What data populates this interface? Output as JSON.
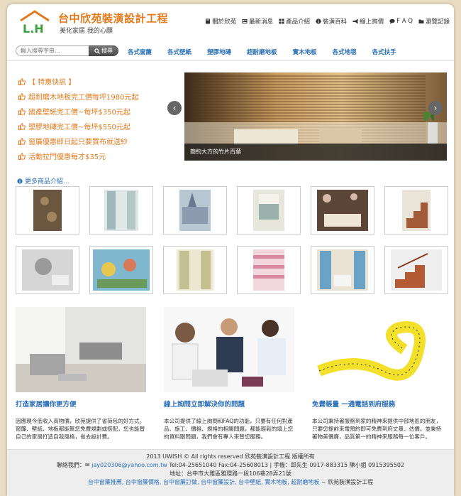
{
  "header": {
    "logo_text": "L.H",
    "title": "台中欣苑裝潢設計工程",
    "subtitle": "美化家居 我的心願",
    "topnav": [
      {
        "label": "關於欣苑",
        "icon": "book-icon"
      },
      {
        "label": "最新消息",
        "icon": "news-icon"
      },
      {
        "label": "產品介紹",
        "icon": "grid-icon"
      },
      {
        "label": "裝潢百科",
        "icon": "info-icon"
      },
      {
        "label": "線上詢價",
        "icon": "megaphone-icon"
      },
      {
        "label": "F A Q",
        "icon": "chat-icon"
      },
      {
        "label": "瀏覽記錄",
        "icon": "folder-icon"
      }
    ]
  },
  "search": {
    "placeholder": "輸入搜尋字串...",
    "button_label": "搜尋"
  },
  "categories": [
    "各式窗簾",
    "各式壁紙",
    "塑膠地磚",
    "超耐磨地板",
    "實木地板",
    "各式地毯",
    "各式扶手"
  ],
  "promo": [
    "【 特惠快訊 】",
    "超耐磨木地板完工價每坪1980元起",
    "國產壁紙完工價~每坪$350元起",
    "塑膠地磚完工價~每坪$550元起",
    "窗簾優惠即日起只要買布就送紗",
    "活動拉門優惠每才$35元"
  ],
  "slider": {
    "caption": "簡約大方的竹片百葉",
    "prev": "‹",
    "next": "›"
  },
  "more_products": "更多商品介紹...",
  "thumbnails": [
    "wallpaper-brown",
    "curtain-white",
    "wallpaper-paris",
    "curtain-window",
    "bedroom-floral",
    "wooden-stairs",
    "wallpaper-living",
    "kids-mural",
    "curtain-lace",
    "pink-stripes",
    "curtain-blue",
    "handrail-stairs"
  ],
  "features": [
    {
      "title": "打造家居讓你更方便",
      "text": "因應現今低收入高物價，欣苑提供了省荷包的好方式。窗簾、壁紙、地板都能幫您免費規劃或搭配，您也能替自己的家居打造自我風格，省去設計費。"
    },
    {
      "title": "線上詢問立即解決你的問題",
      "text": "本公司提供了線上詢問和FAQ的功能，只要有任何對產品、施工、價格、規格的相關問題，都能輕鬆的填上您的資料跟問題，我們會有專人來替您服務。"
    },
    {
      "title": "免費帳量 一通電話到府服務",
      "text": "本公司秉持著服務到家的精神來提供中部地區的朋友，只要您提前來電預約即可免費到府丈量、估價。並秉持著物美價廉，品質第一的精神來服務每一位客戶。"
    }
  ],
  "footer": {
    "copyright": "2013 UWISH © All rights reserved 欣苑裝潢設計工程 版權所有",
    "contact_prefix": "聯絡我們：",
    "email": "jay020306@yahoo.com.tw",
    "contact_rest": "Tel:04-25651040 Fax:04-25608013 | 手機：邱先生 0917-883315 陳小姐 0915395502",
    "address": "地址：台中市大雅區雅環路一段106巷28弄21號",
    "links": "台中窗簾推薦, 台中窗簾價格, 台中窗簾訂做, 台中窗簾設計, 台中壁紙, 實木地板, 超耐磨地板",
    "links_suffix": " ~ 欣苑裝潢設計工程"
  },
  "colors": {
    "accent_orange": "#e07a1c",
    "link_blue": "#2a6fb8",
    "background": "#e9dcc3"
  }
}
